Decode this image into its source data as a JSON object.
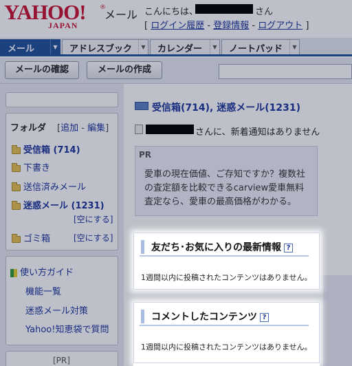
{
  "header": {
    "logo": "YAHOO!",
    "logo_sub": "JAPAN",
    "logo_reg": "®",
    "service": "メール",
    "greeting_prefix": "こんにちは、",
    "greeting_suffix": "さん",
    "links_open": "[",
    "login_history": "ログイン履歴",
    "sep1": "-",
    "registration": "登録情報",
    "sep2": "-",
    "logout": "ログアウト",
    "links_close": "]"
  },
  "nav": {
    "tabs": [
      {
        "label": "メール"
      },
      {
        "label": "アドレスブック"
      },
      {
        "label": "カレンダー"
      },
      {
        "label": "ノートパッド"
      }
    ],
    "arrow": "▼"
  },
  "toolbar": {
    "check_mail": "メールの確認",
    "compose": "メールの作成"
  },
  "sidebar": {
    "folders_title": "フォルダ",
    "folders_actions_open": "[",
    "add": "追加",
    "actions_sep": "-",
    "edit": "編集",
    "folders_actions_close": "]",
    "folders": [
      {
        "label": "受信箱 (714)"
      },
      {
        "label": "下書き"
      },
      {
        "label": "送信済みメール"
      },
      {
        "label": "迷惑メール (1231)"
      },
      {
        "label": "ゴミ箱"
      }
    ],
    "empty_action": "[空にする]",
    "help": {
      "title": "使い方ガイド",
      "items": [
        "機能一覧",
        "迷惑メール対策",
        "Yahoo!知恵袋で質問"
      ]
    },
    "pr_label": "[PR]"
  },
  "main": {
    "inbox_summary": "受信箱(714), 迷惑メール(1231)",
    "notify_text": "さんに、新着通知はありません",
    "pr": {
      "label": "PR",
      "text": "愛車の現在価値、ご存知ですか？複数社の査定額を比較できるcarview愛車無料査定なら、愛車の最高価格がわかる。"
    },
    "friends_box": {
      "title": "友だち･お気に入りの最新情報",
      "help": "?",
      "message": "1週間以内に投稿されたコンテンツはありません。"
    },
    "comments_box": {
      "title": "コメントしたコンテンツ",
      "help": "?",
      "message": "1週間以内に投稿されたコンテンツはありません。"
    }
  },
  "colors": {
    "brand_red": "#c8102e",
    "nav_blue": "#1e4f97",
    "link_blue": "#1a3399"
  }
}
